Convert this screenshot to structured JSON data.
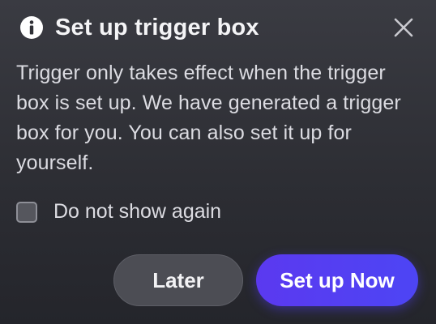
{
  "dialog": {
    "title": "Set up trigger box",
    "message": "Trigger only takes effect when the trigger box is set up. We have generated a trigger box for you. You can also set it up for yourself.",
    "checkbox": {
      "label": "Do not show again",
      "checked": false
    },
    "buttons": {
      "later_label": "Later",
      "primary_label": "Set up Now"
    },
    "icons": {
      "header": "info-icon",
      "close": "close-icon"
    },
    "colors": {
      "primary_button": "#5b39f0",
      "secondary_button": "#4c4d54",
      "background": "#2d2e34"
    }
  }
}
